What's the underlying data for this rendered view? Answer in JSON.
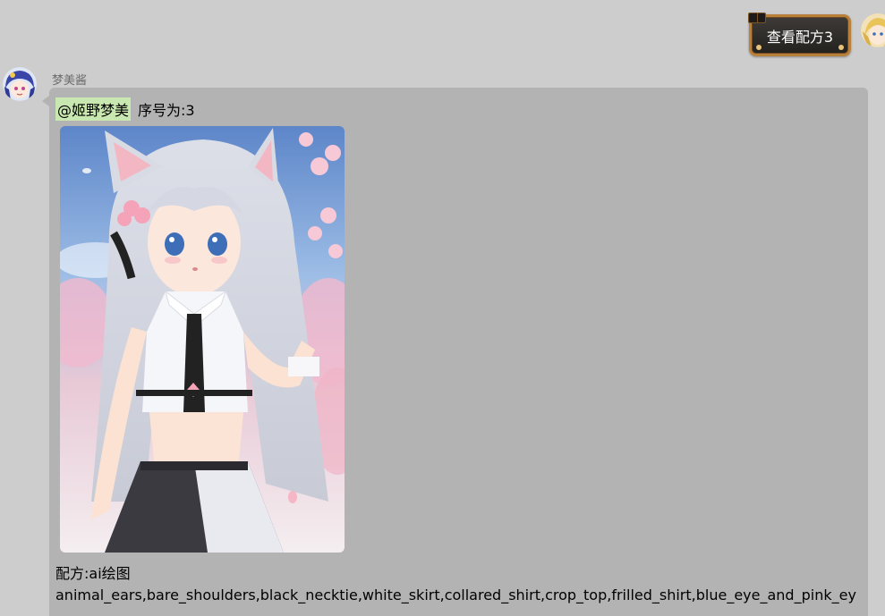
{
  "outgoing": {
    "button_label": "查看配方3"
  },
  "incoming": {
    "sender_name": "梦美酱",
    "mention": "@姬野梦美",
    "index_text": "序号为:3",
    "recipe_label": "配方:ai绘图",
    "tags_text": "animal_ears,bare_shoulders,black_necktie,white_skirt,collared_shirt,crop_top,frilled_shirt,blue_eye_and_pink_ey"
  },
  "colors": {
    "background": "#cdcdcd",
    "incoming_bubble": "#b3b3b3",
    "mention_highlight": "#c9e7b0",
    "outgoing_bubble_border": "#b8803a",
    "outgoing_bubble_fill": "#2e2b28"
  },
  "icons": {
    "self_avatar": "avatar-icon",
    "bot_avatar": "avatar-icon"
  }
}
